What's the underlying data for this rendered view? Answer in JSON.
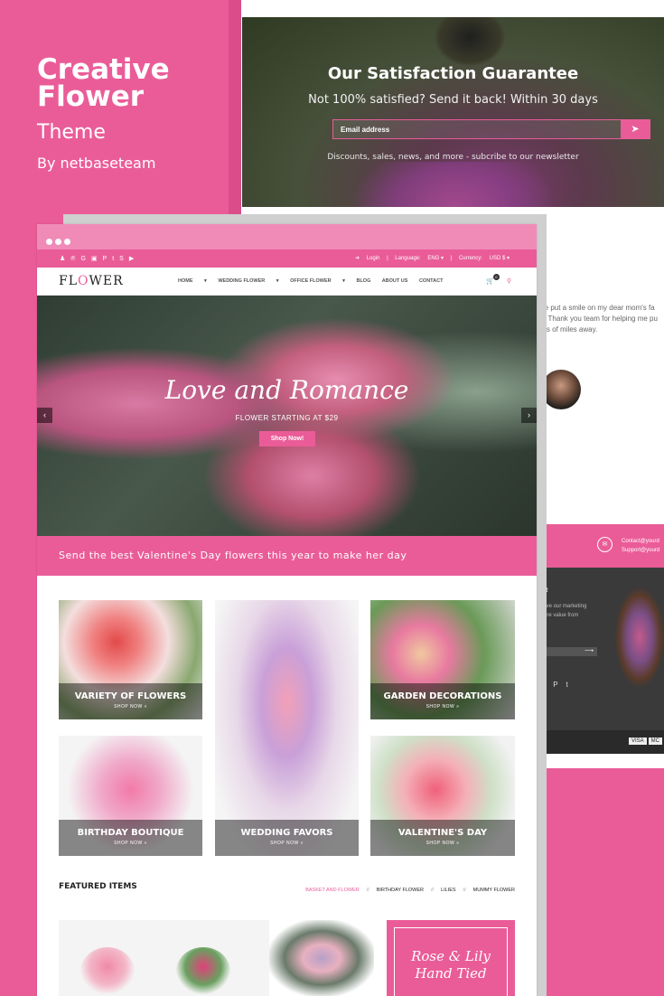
{
  "poster": {
    "title_line1": "Creative",
    "title_line2": "Flower",
    "subtitle": "Theme",
    "byline": "By netbaseteam"
  },
  "newsletter": {
    "title": "Our Satisfaction Guarantee",
    "subtitle": "Not 100% satisfied? Send it back! Within 30 days",
    "email_placeholder": "Email address",
    "submit_icon": "paper-plane-icon",
    "note": "Discounts, sales, news, and more - subcribe to our newsletter"
  },
  "testimonial": {
    "line1": "me put a smile on my dear mom's fa",
    "line2": "so Thank you team for helping me pu",
    "line3": "eds of miles away."
  },
  "contact": {
    "line1": "Contact@yourd",
    "line2": "Support@yourd"
  },
  "footer": {
    "title": "ER",
    "text_line1": "ceive our marketing",
    "text_line2": "more value from",
    "cards": [
      "VISA",
      "MC"
    ]
  },
  "browser": {
    "topbar": {
      "login": "Login",
      "language_label": "Language:",
      "language_value": "ENG",
      "currency_label": "Currency:",
      "currency_value": "USD $"
    },
    "logo": {
      "pre": "FL",
      "mid": "O",
      "post": "WER"
    },
    "menu": [
      "HOME",
      "WEDDING FLOWER",
      "OFFICE FLOWER",
      "BLOG",
      "ABOUT US",
      "CONTACT"
    ],
    "cart_count": "0",
    "hero": {
      "title": "Love and Romance",
      "subtitle": "FLOWER STARTING AT $29",
      "button": "Shop Now!"
    },
    "promo": "Send the best Valentine's Day flowers this year to make her day",
    "categories": [
      {
        "title": "VARIETY OF FLOWERS",
        "cta": "SHOP NOW »"
      },
      {
        "title": "WEDDING FAVORS",
        "cta": "SHOP NOW »"
      },
      {
        "title": "GARDEN DECORATIONS",
        "cta": "SHOP NOW »"
      },
      {
        "title": "BIRTHDAY BOUTIQUE",
        "cta": "SHOP NOW »"
      },
      {
        "title": "VALENTINE'S DAY",
        "cta": "SHOP NOW »"
      }
    ],
    "featured": {
      "heading": "FEATURED ITEMS",
      "tabs": [
        "BASKET AND FLOWER",
        "BIRTHDAY FLOWER",
        "LILIES",
        "MUMMY FLOWER"
      ]
    },
    "banner": {
      "line1": "Rose & Lily",
      "line2": "Hand Tied"
    }
  },
  "colors": {
    "accent": "#ea5c98",
    "dark": "#3a3a3a"
  }
}
